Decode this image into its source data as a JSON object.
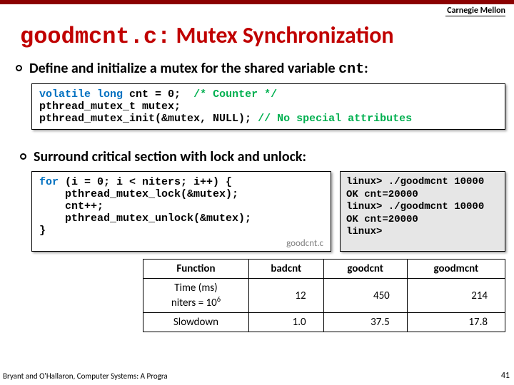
{
  "header": {
    "institution": "Carnegie Mellon",
    "title_mono": "goodmcnt.c:",
    "title_rest": " Mutex Synchronization"
  },
  "bullets": {
    "b1_pre": "Define and initialize a mutex for the shared variable ",
    "b1_mono": "cnt",
    "b1_post": ":",
    "b2": "Surround critical section with lock and unlock:"
  },
  "code1": {
    "l1a": "volatile long",
    "l1b": " cnt = 0;  ",
    "l1c": "/* Counter */",
    "l2": "pthread_mutex_t mutex;",
    "l3a": "pthread_mutex_init(&mutex, NULL); ",
    "l3b": "// No special attributes"
  },
  "code2": {
    "l1a": "for",
    "l1b": " (i = 0; i < niters; i++) {",
    "l2": "    pthread_mutex_lock(&mutex);",
    "l3": "    cnt++;",
    "l4": "    pthread_mutex_unlock(&mutex);",
    "l5": "}",
    "label": "goodcnt.c"
  },
  "terminal": {
    "l1": "linux> ./goodmcnt 10000",
    "l2": "OK cnt=20000",
    "l3": "linux> ./goodmcnt 10000",
    "l4": "OK cnt=20000",
    "l5": "linux>"
  },
  "table": {
    "hdr": {
      "c0": "Function",
      "c1": "badcnt",
      "c2": "goodcnt",
      "c3": "goodmcnt"
    },
    "row1": {
      "c0a": "Time (ms)",
      "c0b": "niters = 10",
      "c0sup": "6",
      "c1": "12",
      "c2": "450",
      "c3": "214"
    },
    "row2": {
      "c0": "Slowdown",
      "c1": "1.0",
      "c2": "37.5",
      "c3": "17.8"
    }
  },
  "footer": {
    "text": "Bryant and O'Hallaron, Computer Systems: A Progra",
    "page": "41"
  },
  "chart_data": {
    "type": "table",
    "title": "Mutex synchronization timing comparison",
    "columns": [
      "Function",
      "badcnt",
      "goodcnt",
      "goodmcnt"
    ],
    "rows": [
      {
        "metric": "Time (ms) niters = 10^6",
        "badcnt": 12,
        "goodcnt": 450,
        "goodmcnt": 214
      },
      {
        "metric": "Slowdown",
        "badcnt": 1.0,
        "goodcnt": 37.5,
        "goodmcnt": 17.8
      }
    ]
  }
}
